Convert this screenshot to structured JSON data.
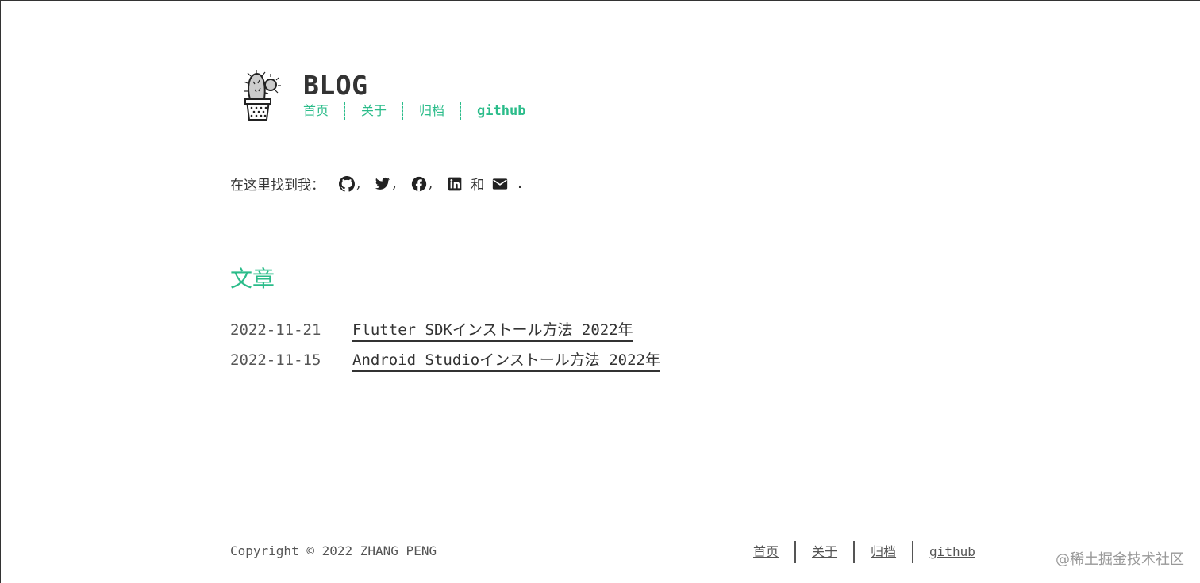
{
  "header": {
    "title": "BLOG",
    "nav": [
      {
        "label": "首页"
      },
      {
        "label": "关于"
      },
      {
        "label": "归档"
      },
      {
        "label": "github"
      }
    ]
  },
  "social": {
    "prefix": "在这里找到我：",
    "comma": ",",
    "and": "和",
    "period": ".",
    "icons": [
      "github-icon",
      "twitter-icon",
      "facebook-icon",
      "linkedin-icon",
      "mail-icon"
    ]
  },
  "posts": {
    "heading": "文章",
    "items": [
      {
        "date": "2022-11-21",
        "title": "Flutter SDKインストール方法 2022年"
      },
      {
        "date": "2022-11-15",
        "title": "Android Studioインストール方法 2022年"
      }
    ]
  },
  "footer": {
    "copyright": "Copyright © 2022 ZHANG PENG",
    "nav": [
      {
        "label": "首页"
      },
      {
        "label": "关于"
      },
      {
        "label": "归档"
      },
      {
        "label": "github"
      }
    ]
  },
  "watermark": "@稀土掘金技术社区",
  "colors": {
    "accent": "#2bbc8a",
    "text": "#333333"
  }
}
